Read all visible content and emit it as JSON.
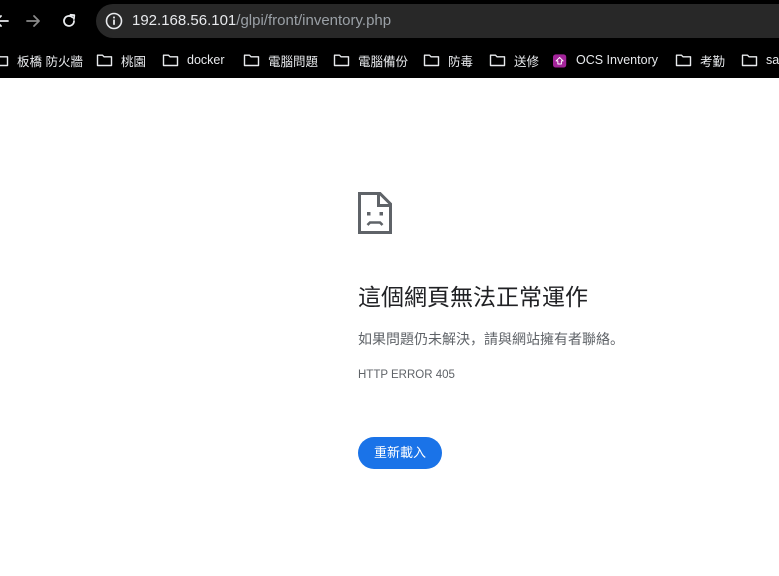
{
  "address_bar": {
    "host": "192.168.56.101",
    "path": "/glpi/front/inventory.php"
  },
  "bookmarks": [
    {
      "label": "板橋 防火牆",
      "icon": "folder-icon"
    },
    {
      "label": "桃園",
      "icon": "folder-icon"
    },
    {
      "label": "docker",
      "icon": "folder-icon"
    },
    {
      "label": "電腦問題",
      "icon": "folder-icon"
    },
    {
      "label": "電腦備份",
      "icon": "folder-icon"
    },
    {
      "label": "防毒",
      "icon": "folder-icon"
    },
    {
      "label": "送修",
      "icon": "folder-icon"
    },
    {
      "label": "OCS Inventory",
      "icon": "ocs-icon"
    },
    {
      "label": "考勤",
      "icon": "folder-icon"
    },
    {
      "label": "sa",
      "icon": "folder-icon"
    }
  ],
  "error_page": {
    "title": "這個網頁無法正常運作",
    "description": "如果問題仍未解決，請與網站擁有者聯絡。",
    "error_code": "HTTP ERROR 405",
    "reload_label": "重新載入"
  },
  "colors": {
    "toolbar_bg": "#000000",
    "omnibox_bg": "#282828",
    "accent": "#1a73e8",
    "ocs_icon": "#a3249a"
  }
}
